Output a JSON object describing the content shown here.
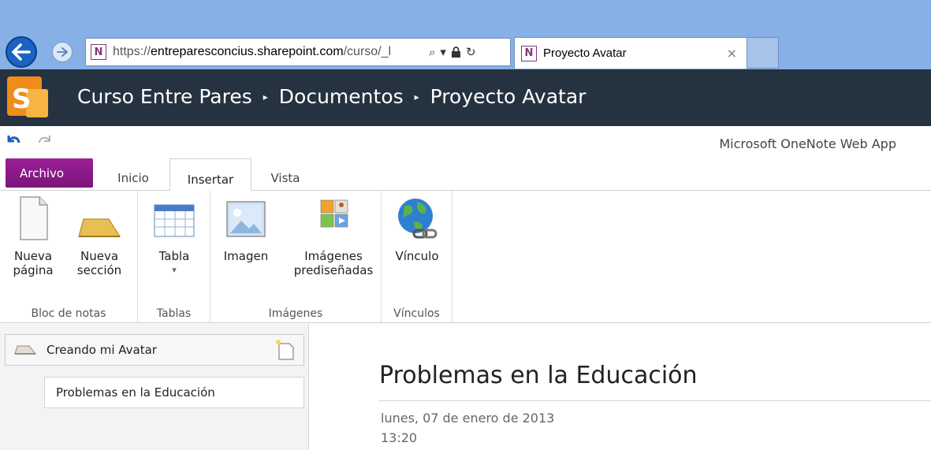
{
  "browser": {
    "url_prefix": "https://",
    "url_domain": "entreparesconcius.sharepoint.com",
    "url_path": "/curso/_l",
    "tab_title": "Proyecto Avatar",
    "tab_close": "×",
    "onenote_glyph": "N",
    "search_glyph": "⌕",
    "dropdown_glyph": "▾",
    "lock_glyph": "🔒",
    "refresh_glyph": "↻"
  },
  "sharepoint": {
    "breadcrumb": [
      "Curso Entre Pares",
      "Documentos",
      "Proyecto Avatar"
    ],
    "separator": "▸"
  },
  "app_name": "Microsoft OneNote Web App",
  "ribbon_tabs": {
    "archivo": "Archivo",
    "inicio": "Inicio",
    "insertar": "Insertar",
    "vista": "Vista"
  },
  "ribbon": {
    "groups": {
      "notebook": "Bloc de notas",
      "tables": "Tablas",
      "images": "Imágenes",
      "links": "Vínculos"
    },
    "buttons": {
      "new_page_1": "Nueva",
      "new_page_2": "página",
      "new_section_1": "Nueva",
      "new_section_2": "sección",
      "table": "Tabla",
      "table_arrow": "▾",
      "image": "Imagen",
      "clipart_1": "Imágenes",
      "clipart_2": "prediseñadas",
      "link": "Vínculo"
    }
  },
  "nav": {
    "section": "Creando mi Avatar",
    "page": "Problemas en la Educación"
  },
  "page": {
    "title": "Problemas en la Educación",
    "date": "lunes, 07 de enero de 2013",
    "time": "13:20"
  },
  "colors": {
    "sharepoint_bar": "#25323f",
    "browser_bar": "#86b0e6",
    "archivo_tab": "#8a1a87",
    "onenote_purple": "#80397b"
  }
}
